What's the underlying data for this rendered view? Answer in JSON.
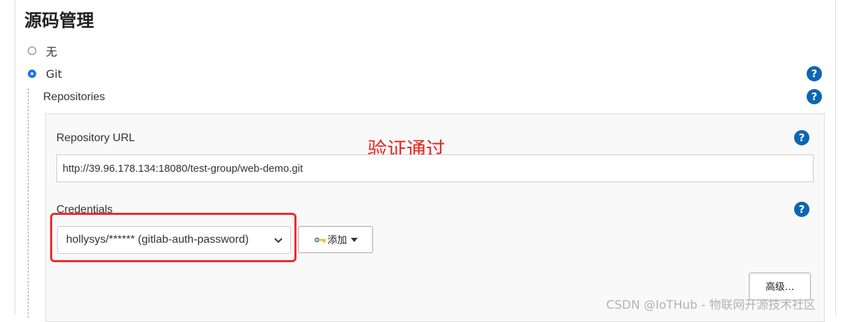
{
  "section": {
    "title": "源码管理"
  },
  "scm_options": [
    {
      "label": "无",
      "checked": false
    },
    {
      "label": "Git",
      "checked": true
    }
  ],
  "repositories": {
    "label": "Repositories",
    "url_label": "Repository URL",
    "url_value": "http://39.96.178.134:18080/test-group/web-demo.git",
    "credentials_label": "Credentials",
    "credentials_selected": "hollysys/****** (gitlab-auth-password)",
    "add_button_label": "添加",
    "advanced_button_label": "高级..."
  },
  "help_icon_glyph": "?",
  "annotation": {
    "text": "验证通过",
    "color": "#e8221b"
  },
  "watermark": "CSDN @IoTHub - 物联网开源技术社区",
  "colors": {
    "help_icon": "#0c67b1",
    "highlight_frame": "#ee2a2a",
    "radio_checked": "#1a73e8"
  },
  "icons": {
    "help": "help-circle-icon",
    "key": "key-icon",
    "dropdown": "chevron-down-icon",
    "caret": "caret-down-icon"
  }
}
